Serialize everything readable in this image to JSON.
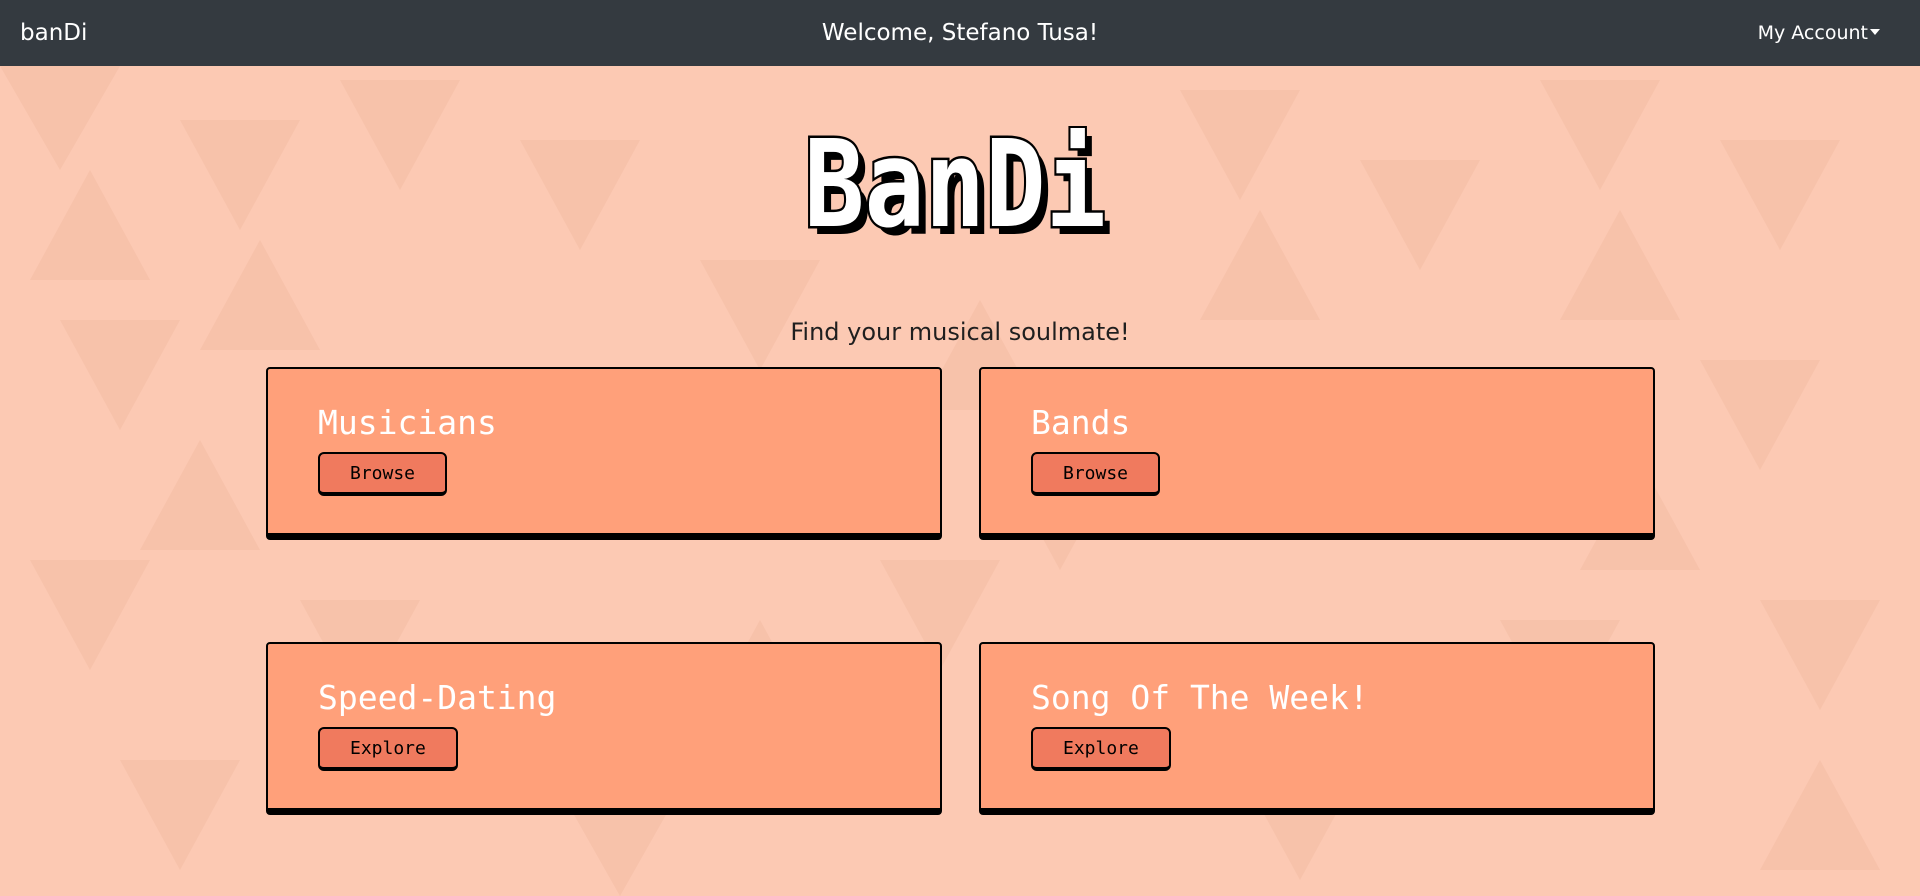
{
  "navbar": {
    "brand": "banDi",
    "welcome": "Welcome, Stefano Tusa!",
    "account_label": "My Account"
  },
  "hero": {
    "logo_text": "BanDi",
    "tagline": "Find your musical soulmate!"
  },
  "cards": [
    {
      "title": "Musicians",
      "button": "Browse"
    },
    {
      "title": "Bands",
      "button": "Browse"
    },
    {
      "title": "Speed-Dating",
      "button": "Explore"
    },
    {
      "title": "Song Of The Week!",
      "button": "Explore"
    }
  ],
  "colors": {
    "navbar_bg": "#343a40",
    "page_bg": "#fcc9b3",
    "card_bg": "#ffa07a",
    "button_bg": "#f07a5e"
  },
  "icons": {
    "account_dropdown": "caret-down-icon"
  }
}
